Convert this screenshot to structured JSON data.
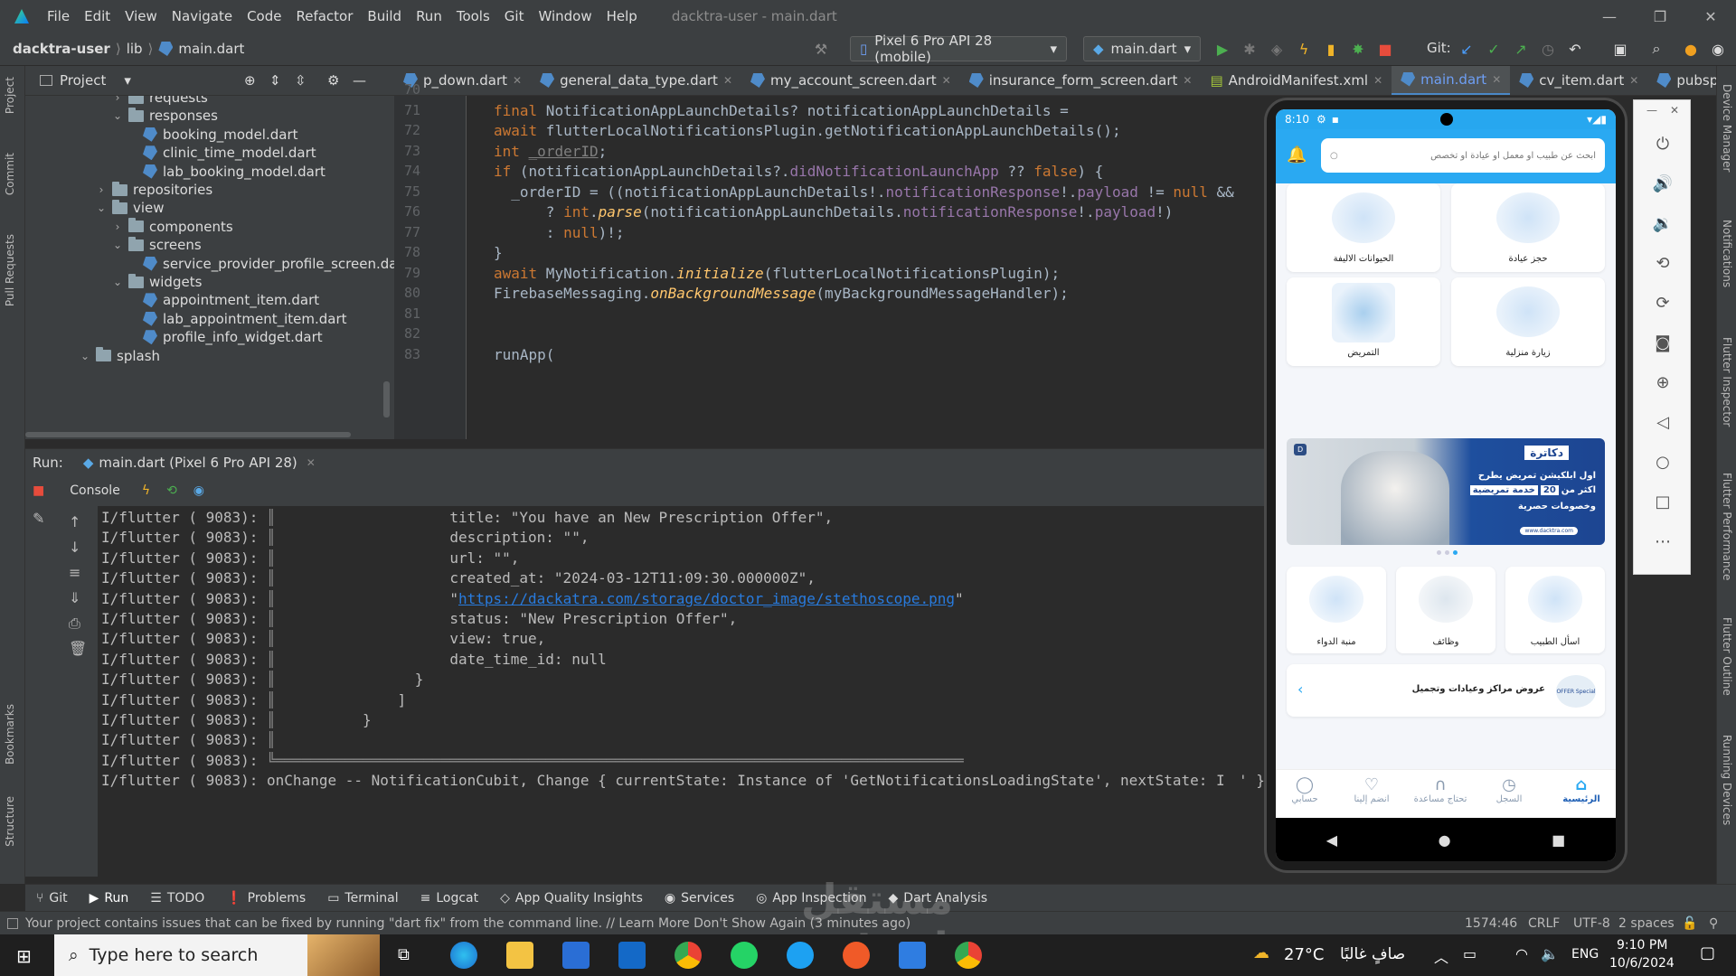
{
  "window": {
    "title": "dacktra-user - main.dart"
  },
  "menu": [
    "File",
    "Edit",
    "View",
    "Navigate",
    "Code",
    "Refactor",
    "Build",
    "Run",
    "Tools",
    "Git",
    "Window",
    "Help"
  ],
  "breadcrumb": {
    "project": "dacktra-user",
    "dir": "lib",
    "file": "main.dart"
  },
  "toolbar": {
    "device": "Pixel 6 Pro API 28 (mobile)",
    "config": "main.dart",
    "git_label": "Git:"
  },
  "project_panel": {
    "title": "Project",
    "tree": [
      {
        "label": "requests",
        "type": "folder",
        "level": 1,
        "open": false
      },
      {
        "label": "responses",
        "type": "folder",
        "level": 1,
        "open": true
      },
      {
        "label": "booking_model.dart",
        "type": "file",
        "level": 2
      },
      {
        "label": "clinic_time_model.dart",
        "type": "file",
        "level": 2
      },
      {
        "label": "lab_booking_model.dart",
        "type": "file",
        "level": 2
      },
      {
        "label": "repositories",
        "type": "folder",
        "level": 0,
        "open": false
      },
      {
        "label": "view",
        "type": "folder",
        "level": 0,
        "open": true
      },
      {
        "label": "components",
        "type": "folder",
        "level": 1,
        "open": false
      },
      {
        "label": "screens",
        "type": "folder",
        "level": 1,
        "open": true
      },
      {
        "label": "service_provider_profile_screen.da",
        "type": "file",
        "level": 2
      },
      {
        "label": "widgets",
        "type": "folder",
        "level": 1,
        "open": true
      },
      {
        "label": "appointment_item.dart",
        "type": "file",
        "level": 2
      },
      {
        "label": "lab_appointment_item.dart",
        "type": "file",
        "level": 2
      },
      {
        "label": "profile_info_widget.dart",
        "type": "file",
        "level": 2
      },
      {
        "label": "splash",
        "type": "folder",
        "level": -1,
        "open": true
      }
    ]
  },
  "editor_tabs": [
    {
      "label": "p_down.dart",
      "active": false
    },
    {
      "label": "general_data_type.dart",
      "active": false
    },
    {
      "label": "my_account_screen.dart",
      "active": false
    },
    {
      "label": "insurance_form_screen.dart",
      "active": false
    },
    {
      "label": "AndroidManifest.xml",
      "active": false
    },
    {
      "label": "main.dart",
      "active": true
    },
    {
      "label": "cv_item.dart",
      "active": false
    },
    {
      "label": "pubspec.yam",
      "active": false
    }
  ],
  "code_lines": [
    {
      "n": "70",
      "t": ""
    },
    {
      "n": "71",
      "t": "final NotificationAppLaunchDetails? notificationAppLaunchDetails ="
    },
    {
      "n": "72",
      "t": "await flutterLocalNotificationsPlugin.getNotificationAppLaunchDetails();"
    },
    {
      "n": "73",
      "t": "int _orderID;"
    },
    {
      "n": "74",
      "t": "if (notificationAppLaunchDetails?.didNotificationLaunchApp ?? false) {"
    },
    {
      "n": "75",
      "t": "  _orderID = ((notificationAppLaunchDetails!.notificationResponse!.payload != null &&"
    },
    {
      "n": "76",
      "t": "      ? int.parse(notificationAppLaunchDetails.notificationResponse!.payload!)"
    },
    {
      "n": "77",
      "t": "      : null)!;"
    },
    {
      "n": "78",
      "t": "}"
    },
    {
      "n": "79",
      "t": "await MyNotification.initialize(flutterLocalNotificationsPlugin);"
    },
    {
      "n": "80",
      "t": "FirebaseMessaging.onBackgroundMessage(myBackgroundMessageHandler);"
    },
    {
      "n": "81",
      "t": ""
    },
    {
      "n": "82",
      "t": ""
    },
    {
      "n": "83",
      "t": "runApp("
    }
  ],
  "run": {
    "label": "Run:",
    "config": "main.dart (Pixel 6 Pro API 28)",
    "console_tab": "Console"
  },
  "console_prefix": "I/flutter ( 9083): ",
  "console_lines": [
    "                    title: \"You have an New Prescription Offer\",",
    "                    description: \"\",",
    "                    url: \"\",",
    "                    created_at: \"2024-03-12T11:09:30.000000Z\",",
    "                    \"",
    "                    status: \"New Prescription Offer\",",
    "                    view: true,",
    "                    date_time_id: null",
    "                }",
    "              ]",
    "          }",
    "",
    "",
    "onChange -- NotificationCubit, Change { currentState: Instance of 'GetNotificationsLoadingState', nextState: I"
  ],
  "console_link": "https://dackatra.com/storage/doctor_image/stethoscope.png",
  "console_tail": "' }",
  "tool_windows": [
    "Git",
    "Run",
    "TODO",
    "Problems",
    "Terminal",
    "Logcat",
    "App Quality Insights",
    "Services",
    "App Inspection",
    "Dart Analysis"
  ],
  "status": {
    "message": "Your project contains issues that can be fixed by running \"dart fix\" from the command line. // Learn More  Don't Show Again (3 minutes ago)",
    "position": "1574:46",
    "eol": "CRLF",
    "encoding": "UTF-8",
    "indent": "2 spaces"
  },
  "left_strip": [
    "Project",
    "Commit",
    "Pull Requests",
    "Bookmarks",
    "Structure"
  ],
  "right_strip": [
    "Device Manager",
    "Notifications",
    "Flutter Inspector",
    "Flutter Performance",
    "Flutter Outline",
    "Running Devices"
  ],
  "phone": {
    "time": "8:10",
    "search_placeholder": "ابحث عن طبيب او معمل او عيادة او تخصص",
    "services": [
      {
        "label": "الحيوانات الاليفة"
      },
      {
        "label": "حجز عيادة"
      },
      {
        "label": "التمريض"
      },
      {
        "label": "زيارة منزلية"
      }
    ],
    "banner": {
      "brand": "دكاترة",
      "line1": "اول ابلكيشن تمريض يطرح",
      "line2": "اكثر من",
      "num": "20",
      "line2b": "خدمة تمريضية",
      "line3": "وخصومات حصرية",
      "url": "www.dacktra.com"
    },
    "services2": [
      {
        "label": "منبة الدواء"
      },
      {
        "label": "وظائف"
      },
      {
        "label": "اسأل الطبيب"
      }
    ],
    "offers": {
      "label": "عروض مراكز وعيادات وتجميل",
      "badge": "OFFER Special"
    },
    "nav": [
      {
        "label": "حسابي"
      },
      {
        "label": "انضم إلينا"
      },
      {
        "label": "تحتاج مساعدة"
      },
      {
        "label": "السجل"
      },
      {
        "label": "الرئيسية"
      }
    ]
  },
  "taskbar": {
    "search": "Type here to search",
    "weather": "27°C",
    "weather_text": "صافٍ غالبًا",
    "lang": "ENG",
    "time": "9:10 PM",
    "date": "10/6/2024"
  },
  "watermark": "مستقل mostaql.com"
}
